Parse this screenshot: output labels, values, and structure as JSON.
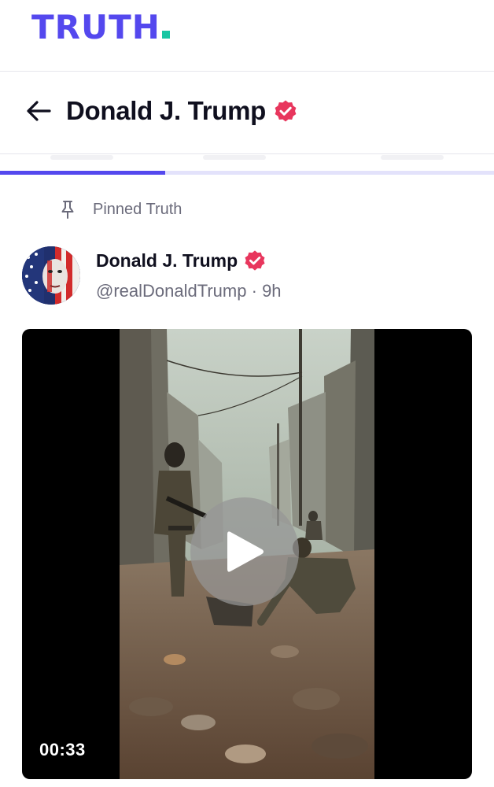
{
  "app": {
    "logo_text": "TRUTH",
    "brand_color": "#5448ee",
    "brand_dot_color": "#17c6a3"
  },
  "header": {
    "back_icon": "arrow-left-icon",
    "title": "Donald J. Trump",
    "verified_color": "#e8365d"
  },
  "tabs": {
    "active_tab_index": 0,
    "tab_count": 3
  },
  "pinned": {
    "icon": "pin-icon",
    "label": "Pinned Truth"
  },
  "post": {
    "author_name": "Donald J. Trump",
    "handle": "@realDonaldTrump",
    "separator": "·",
    "time_ago": "9h",
    "video": {
      "duration": "00:33",
      "play_icon": "play-icon"
    }
  }
}
